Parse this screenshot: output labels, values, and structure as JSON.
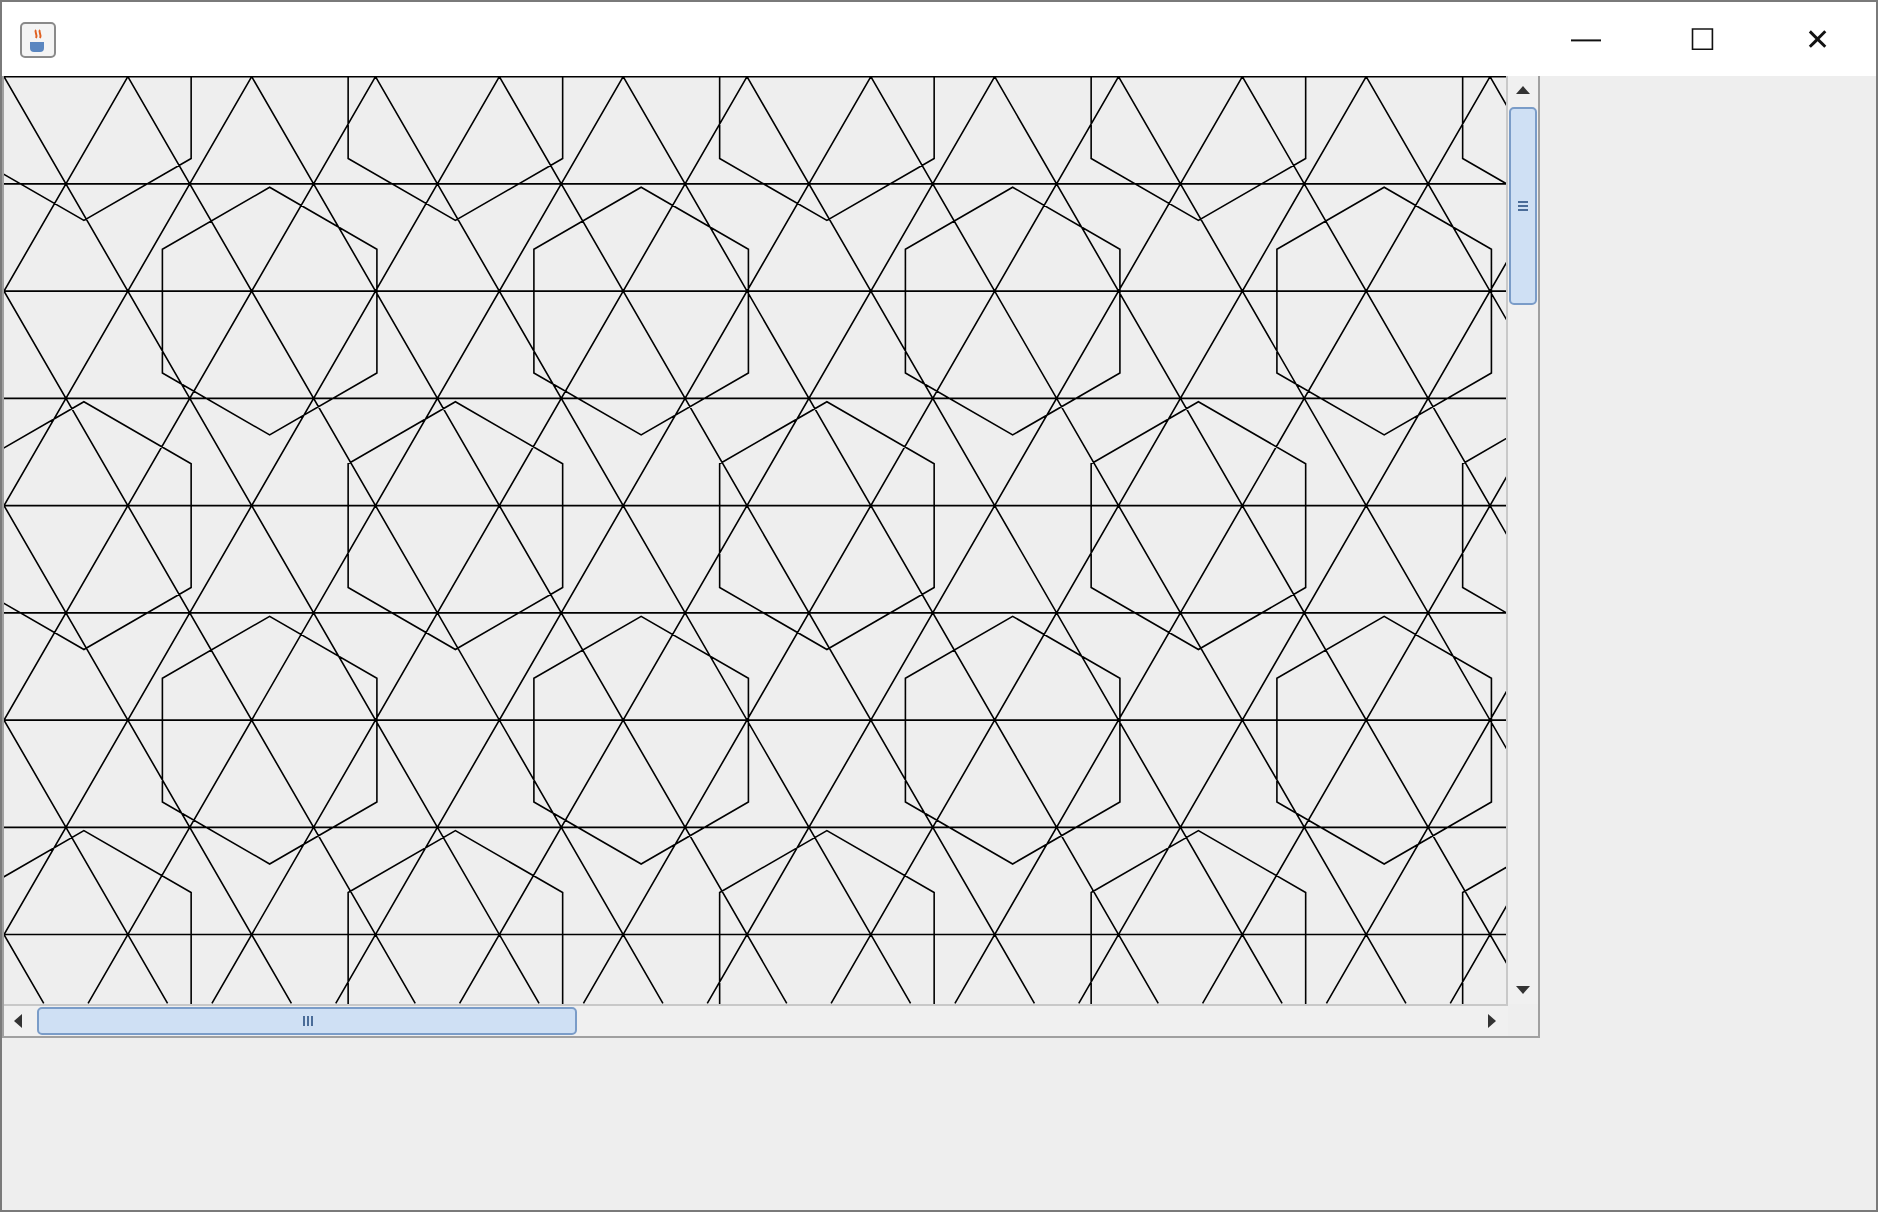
{
  "window": {
    "controls": [
      "—",
      "☐",
      "✕"
    ]
  }
}
